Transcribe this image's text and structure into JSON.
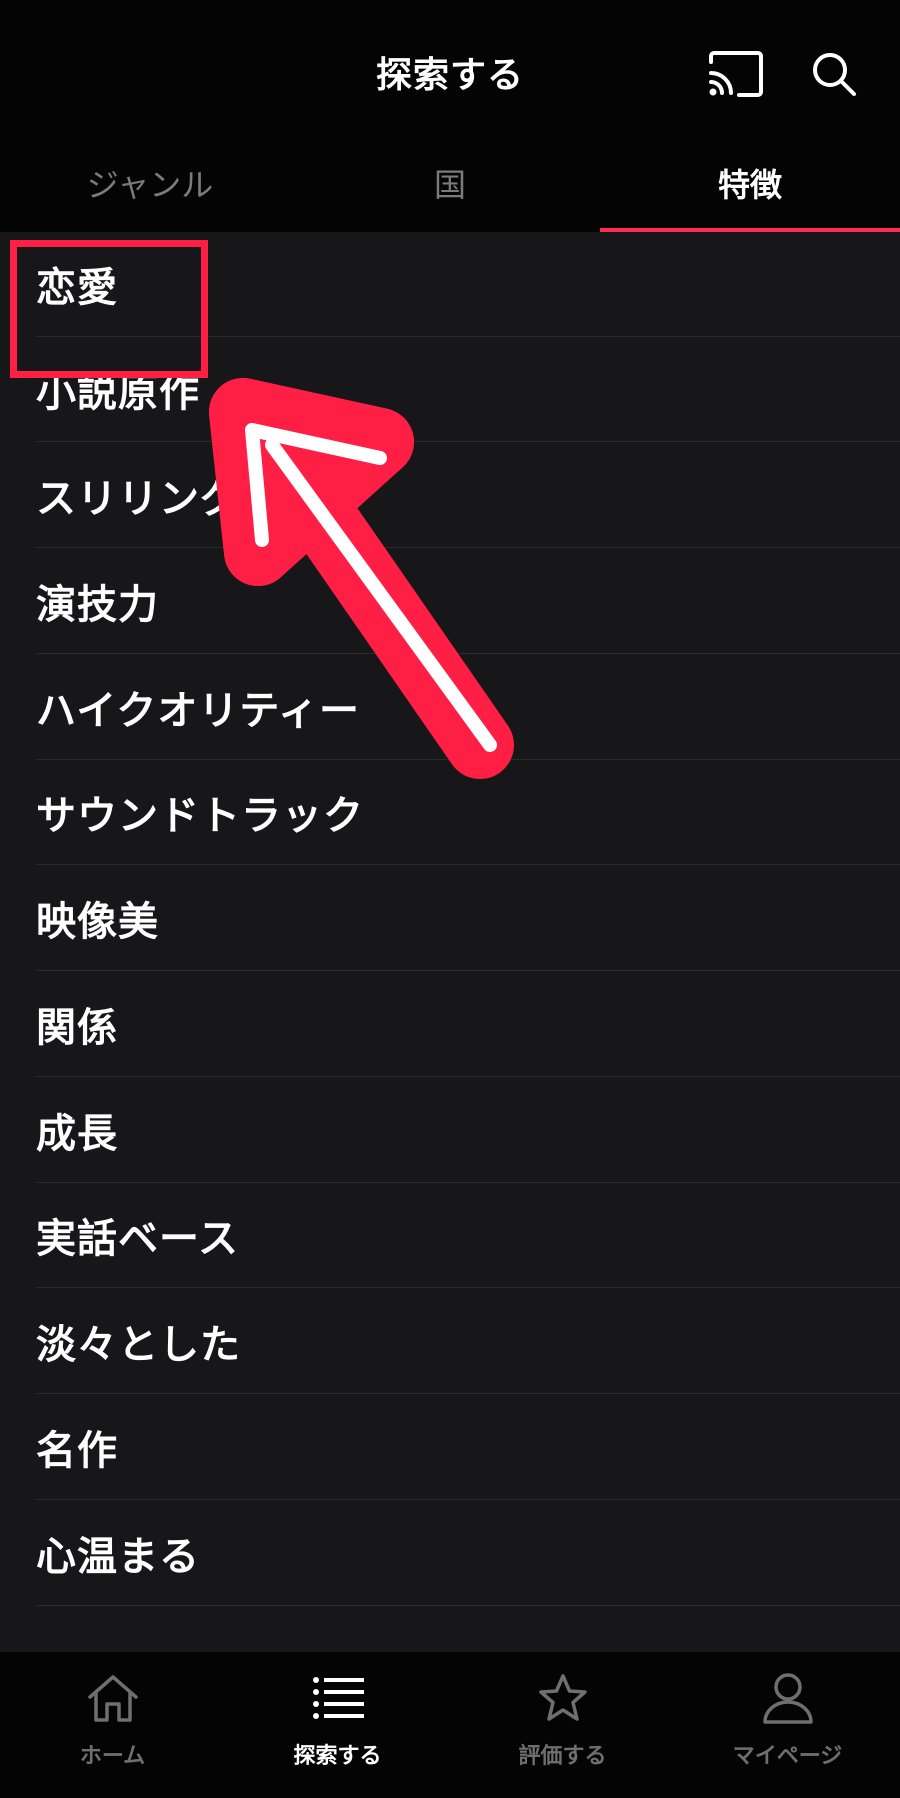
{
  "header": {
    "title": "探索する",
    "cast_icon": "cast-icon",
    "search_icon": "search-icon"
  },
  "tabs": [
    {
      "label": "ジャンル",
      "active": false
    },
    {
      "label": "国",
      "active": false
    },
    {
      "label": "特徴",
      "active": true
    }
  ],
  "features": [
    "恋愛",
    "小説原作",
    "スリリング",
    "演技力",
    "ハイクオリティー",
    "サウンドトラック",
    "映像美",
    "関係",
    "成長",
    "実話ベース",
    "淡々とした",
    "名作",
    "心温まる"
  ],
  "bottom_nav": [
    {
      "label": "ホーム",
      "icon": "home-icon",
      "active": false
    },
    {
      "label": "探索する",
      "icon": "list-icon",
      "active": true
    },
    {
      "label": "評価する",
      "icon": "star-icon",
      "active": false
    },
    {
      "label": "マイページ",
      "icon": "person-icon",
      "active": false
    }
  ],
  "colors": {
    "accent": "#ff2d55",
    "annotation": "#ff1f45",
    "background": "#17171a",
    "bar": "#040404"
  }
}
